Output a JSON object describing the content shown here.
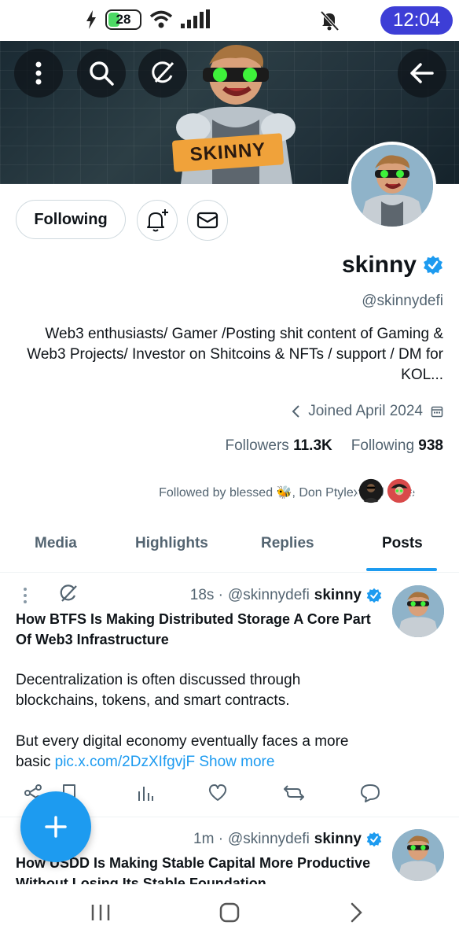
{
  "status_bar": {
    "battery": "28",
    "time": "12:04"
  },
  "banner": {
    "label": "SKINNY"
  },
  "profile": {
    "following_button": "Following",
    "display_name": "skinny",
    "handle": "@skinnydefi",
    "bio": "Web3 enthusiasts/ Gamer /Posting shit content of Gaming & Web3 Projects/ Investor on Shitcoins & NFTs / support / DM for KOL...",
    "joined": "Joined April 2024",
    "followers_label": "Followers",
    "followers_count": "11.3K",
    "following_label": "Following",
    "following_count": "938",
    "followed_by": "Followed by blessed 🐝, Don Ptylex and chae"
  },
  "tabs": [
    {
      "label": "Media"
    },
    {
      "label": "Highlights"
    },
    {
      "label": "Replies"
    },
    {
      "label": "Posts",
      "active": true
    }
  ],
  "posts": [
    {
      "time": "18s ·",
      "handle": "@skinnydefi",
      "name": "skinny",
      "title": "How BTFS Is Making Distributed Storage A Core Part Of Web3 Infrastructure",
      "para1": "Decentralization is often discussed through blockchains, tokens, and smart contracts.",
      "para2": "But every digital economy eventually faces a more basic",
      "link": "pic.x.com/2DzXIfgvjF",
      "show_more": "Show more"
    },
    {
      "time": "1m ·",
      "handle": "@skinnydefi",
      "name": "skinny",
      "title": "How USDD Is Making Stable Capital More Productive Without Losing Its Stable Foundation"
    }
  ],
  "colors": {
    "accent": "#1d9bf0",
    "clock_bg": "#3d3ed6",
    "verified": "#1d9bf0"
  }
}
